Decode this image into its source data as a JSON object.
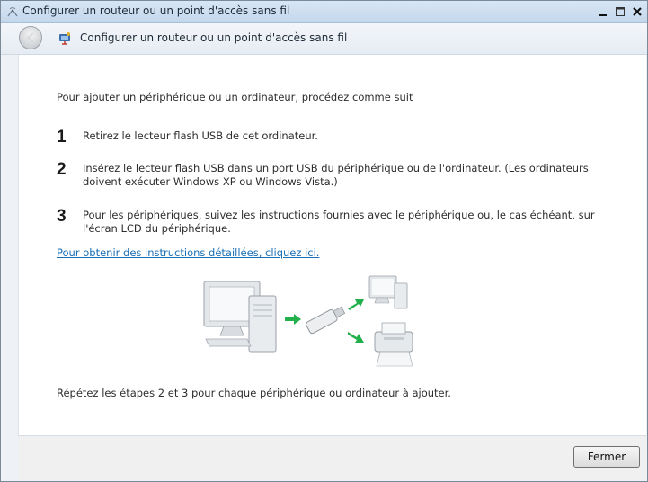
{
  "window": {
    "title": "Configurer un routeur ou un point d'accès sans fil"
  },
  "nav": {
    "title": "Configurer un routeur ou un point d'accès sans fil"
  },
  "content": {
    "intro": "Pour ajouter un périphérique ou un ordinateur, procédez comme suit",
    "steps": [
      {
        "number": "1",
        "text": "Retirez le lecteur flash USB de cet ordinateur."
      },
      {
        "number": "2",
        "text": "Insérez le lecteur flash USB dans un port USB du périphérique ou de l'ordinateur. (Les ordinateurs doivent exécuter Windows XP ou Windows Vista.)"
      },
      {
        "number": "3",
        "text": "Pour les périphériques, suivez les instructions fournies avec le périphérique ou, le cas échéant, sur l'écran LCD du périphérique."
      }
    ],
    "link": "Pour obtenir des instructions détaillées, cliquez ici.",
    "repeat": "Répétez les étapes 2 et 3 pour chaque périphérique ou ordinateur à ajouter."
  },
  "footer": {
    "close_label": "Fermer"
  },
  "icons": {
    "title": "wireless-network-icon",
    "back": "back-arrow-icon",
    "nav": "network-setup-icon",
    "minimize": "minimize-icon",
    "maximize": "maximize-icon",
    "close": "close-icon"
  },
  "colors": {
    "link": "#1a6fb5",
    "arrow": "#22b04b"
  }
}
